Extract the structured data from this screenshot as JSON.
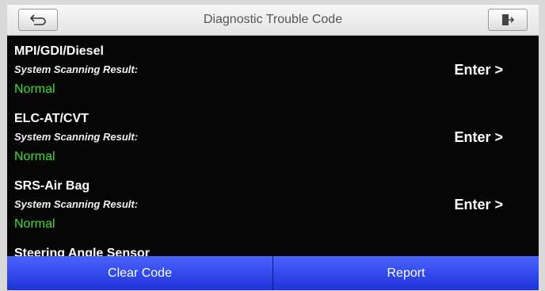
{
  "header": {
    "title": "Diagnostic Trouble Code",
    "back_icon": "back-arrow-icon",
    "exit_icon": "exit-door-icon"
  },
  "systems": [
    {
      "name": "MPI/GDI/Diesel",
      "result_label": "System Scanning Result:",
      "status": "Normal",
      "action": "Enter >"
    },
    {
      "name": "ELC-AT/CVT",
      "result_label": "System Scanning Result:",
      "status": "Normal",
      "action": "Enter >"
    },
    {
      "name": "SRS-Air Bag",
      "result_label": "System Scanning Result:",
      "status": "Normal",
      "action": "Enter >"
    },
    {
      "name": "Steering Angle Sensor"
    }
  ],
  "footer": {
    "clear_label": "Clear Code",
    "report_label": "Report"
  },
  "colors": {
    "status_normal": "#3fe032",
    "button_blue": "#2c44e8",
    "background": "#050505"
  }
}
